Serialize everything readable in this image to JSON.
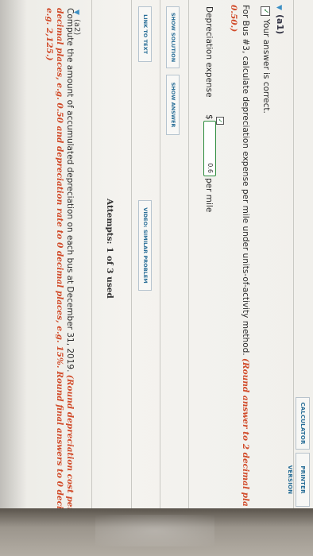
{
  "toolbar": {
    "printer_version": "PRINTER VERSION",
    "calculator": "CALCULATOR"
  },
  "part_a1": {
    "heading": "(a1)",
    "correct_message": "Your answer is correct.",
    "question_text": "For Bus #3, calculate depreciation expense per mile under units-of-activity method.",
    "question_hint": "(Round answer to 2 decimal pla",
    "question_hint_cont": "0.50.)",
    "field_label": "Depreciation expense",
    "currency": "$",
    "answer_value": "0.6",
    "unit": "per mile"
  },
  "actions": {
    "show_solution": "SHOW SOLUTION",
    "show_answer": "SHOW ANSWER",
    "link_to_text": "LINK TO TEXT",
    "video": "VIDEO: SIMILAR PROBLEM"
  },
  "attempts": "Attempts: 1 of 3 used",
  "part_a2": {
    "heading": "(a2)",
    "question_text": "Compute the amount of accumulated depreciation on each bus at December 31, 2019.",
    "hint_line1": "(Round depreciation cost per un",
    "hint_line2": "decimal places, e.g. 0.50 and depreciation rate to 0 decimal places, e.g. 15%. Round final answers to 0 decima",
    "hint_line3": "e.g. 2,125.)"
  }
}
